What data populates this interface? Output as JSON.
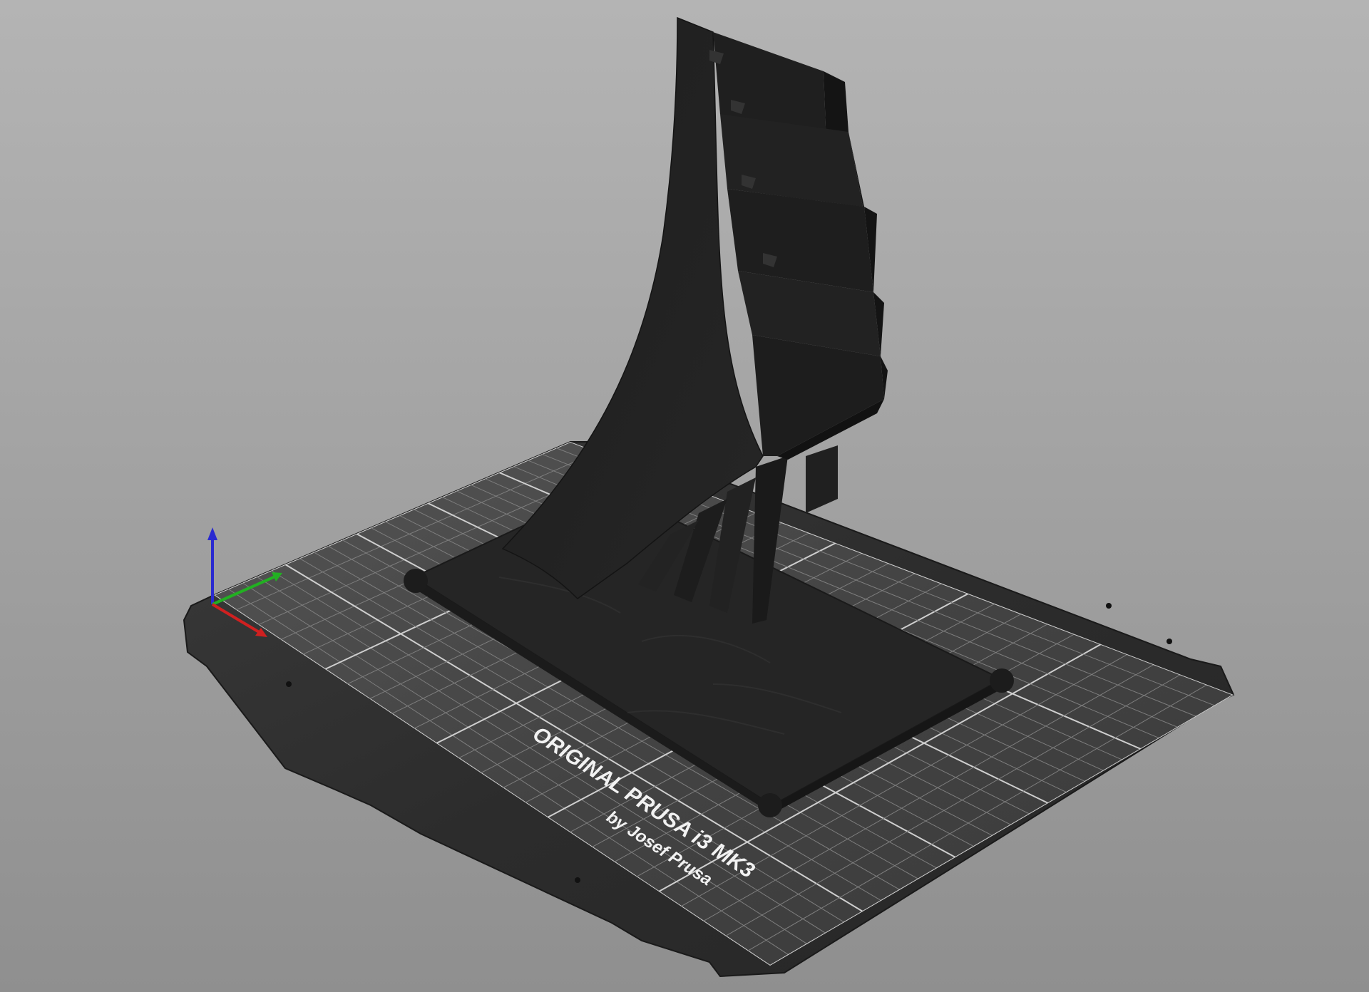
{
  "viewport": {
    "background_color": "#a6a6a6",
    "bed_color": "#2a2a2a",
    "grid_color": "#8a8a8a",
    "model_color": "#1f1f1f"
  },
  "bed": {
    "brand_line": "ORIGINAL PRUSA i3 MK3",
    "author_line": "by Josef Prusa"
  },
  "axes": {
    "x_color": "#d02020",
    "y_color": "#22b022",
    "z_color": "#2a2ad0"
  }
}
